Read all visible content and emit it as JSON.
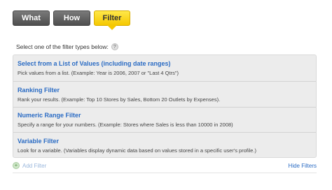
{
  "tabs": [
    {
      "label": "What"
    },
    {
      "label": "How"
    },
    {
      "label": "Filter"
    }
  ],
  "instruction": "Select one of the filter types below:",
  "help_glyph": "?",
  "options": [
    {
      "title": "Select from a List of Values (including date ranges)",
      "description": "Pick values from a list. (Example: Year is 2006, 2007 or \"Last 4 Qtrs\")"
    },
    {
      "title": "Ranking Filter",
      "description": "Rank your results. (Example: Top 10 Stores by Sales, Bottom 20 Outlets by Expenses)."
    },
    {
      "title": "Numeric Range Filter",
      "description": "Specify a range for your numbers. (Example: Stores where Sales is less than 10000 in 2008)"
    },
    {
      "title": "Variable Filter",
      "description": "Look for a variable. (Variables display dynamic data based on values stored in a specific user's profile.)"
    }
  ],
  "add_filter": "Add Filter",
  "add_glyph": "+",
  "hide_filters": "Hide Filters",
  "colors": {
    "active_tab": "#f5c800",
    "link": "#2b6cc4",
    "panel": "#ececec"
  }
}
